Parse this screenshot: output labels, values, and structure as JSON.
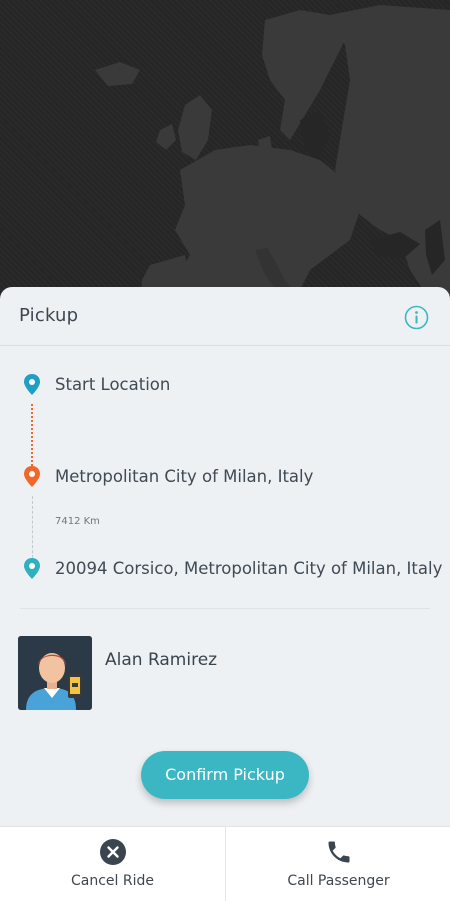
{
  "pickup": {
    "title": "Pickup",
    "start_label": "Start Location",
    "pickup_address": "Metropolitan City of Milan, Italy",
    "distance": "7412 Km",
    "destination_address": "20094 Corsico, Metropolitan City of Milan, Italy"
  },
  "passenger": {
    "name": "Alan Ramirez"
  },
  "actions": {
    "confirm_label": "Confirm Pickup",
    "cancel_label": "Cancel Ride",
    "call_label": "Call Passenger"
  },
  "colors": {
    "accent": "#3bb7c4",
    "pickup_marker": "#f1672a",
    "sheet_background": "#eef1f4",
    "map_background": "#262626"
  },
  "icons": {
    "info": "info-icon",
    "start": "start-location-pin-icon",
    "pickup": "pickup-pin-icon",
    "destination": "destination-pin-icon",
    "cancel": "close-circle-icon",
    "call": "phone-icon"
  }
}
